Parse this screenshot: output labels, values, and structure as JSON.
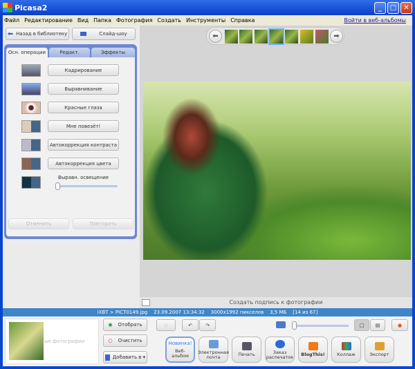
{
  "window": {
    "title": "Picasa2"
  },
  "menu": [
    "Файл",
    "Редактирование",
    "Вид",
    "Папка",
    "Фотография",
    "Создать",
    "Инструменты",
    "Справка"
  ],
  "web_link": "Войти в веб-альбомы",
  "toolbar": {
    "back": "Назад в библиотеку",
    "slideshow": "Слайд-шоу"
  },
  "tabs": [
    "Осн. операции",
    "Редакт.",
    "Эффекты"
  ],
  "operations": [
    "Кадрирование",
    "Выравнивание",
    "Красные глаза",
    "Мне повезёт!",
    "Автокоррекция контраста",
    "Автокоррекция цвета"
  ],
  "fill_light": {
    "label": "Выравн. освещение",
    "value": 0
  },
  "undo": "Отменить",
  "redo": "Повторить",
  "caption_placeholder": "Создать подпись к фотографии",
  "status": {
    "path": "iXBT > PICT0149.jpg",
    "date": "23.09.2007 13:34:32",
    "dims": "3000x1992",
    "dims_unit": "пикселов",
    "size": "3,5 МБ",
    "index": "[14 из 67]"
  },
  "tray": {
    "label": "ые фотографии",
    "select": "Отобрать",
    "clear": "Очистить",
    "add": "Добавить в ▾"
  },
  "actions": [
    {
      "label": "Веб-альбом",
      "badge": "Новинка!"
    },
    {
      "label": "Электронная почта"
    },
    {
      "label": "Печать"
    },
    {
      "label": "Заказ распечаток"
    },
    {
      "label": "BlogThis!"
    },
    {
      "label": "Коллаж"
    },
    {
      "label": "Экспорт"
    }
  ]
}
